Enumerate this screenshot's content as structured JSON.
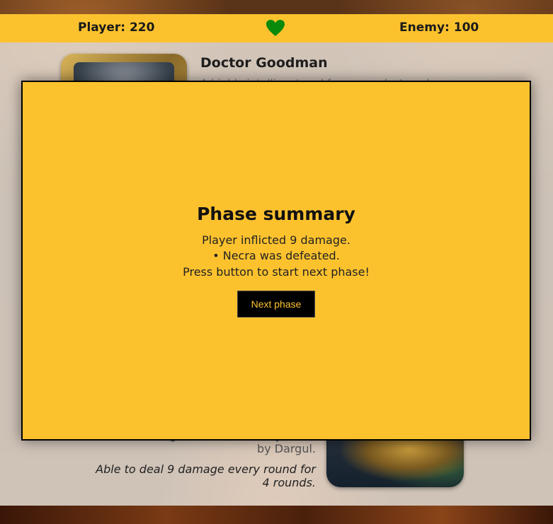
{
  "status": {
    "player_label": "Player: 220",
    "enemy_label": "Enemy: 100",
    "heart_color": "#0a8a0a"
  },
  "cards": {
    "top_name": "Doctor Goodman",
    "top_desc": "A highly intelligent and fearsome doctor who",
    "bottom_desc": "A blathering beast, notoriously killed by Dargul.",
    "bottom_ability": "Able to deal 9 damage every round for 4 rounds."
  },
  "modal": {
    "title": "Phase summary",
    "line1": "Player inflicted 9 damage.",
    "line2": "• Necra was defeated.",
    "line3": "Press button to start next phase!",
    "button_label": "Next phase"
  },
  "colors": {
    "accent": "#fcc22e",
    "button_bg": "#000000"
  }
}
